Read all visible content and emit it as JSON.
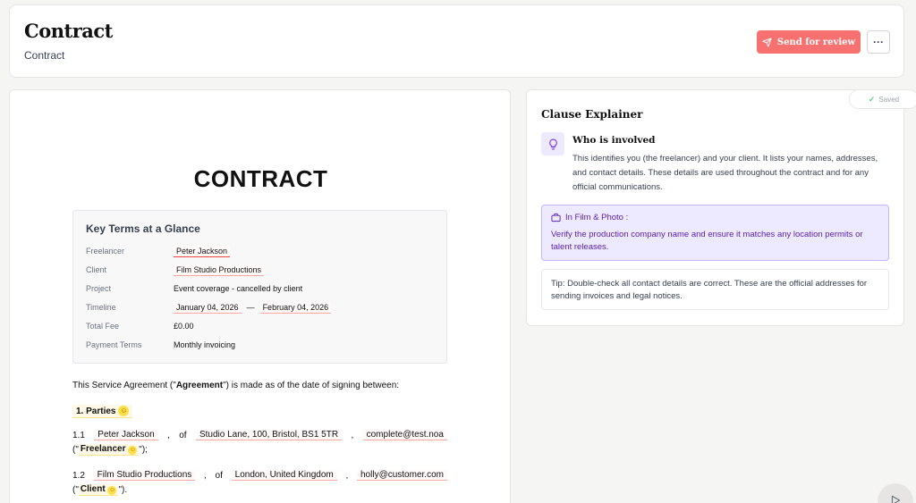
{
  "header": {
    "title": "Contract",
    "subtitle": "Contract",
    "send_label": "Send for review",
    "more_label": "···"
  },
  "document": {
    "title": "CONTRACT",
    "key_terms": {
      "title": "Key Terms at a Glance",
      "rows": {
        "freelancer": {
          "label": "Freelancer",
          "value": "Peter Jackson"
        },
        "client": {
          "label": "Client",
          "value": "Film Studio Productions"
        },
        "project": {
          "label": "Project",
          "value": "Event coverage - cancelled by client"
        },
        "timeline": {
          "label": "Timeline",
          "start": "January 04, 2026",
          "sep": "—",
          "end": "February 04, 2026"
        },
        "total_fee": {
          "label": "Total Fee",
          "value": "£0.00"
        },
        "payment_terms": {
          "label": "Payment Terms",
          "value": "Monthly invoicing"
        }
      }
    },
    "intro": {
      "before": "This Service Agreement (\"",
      "term": "Agreement",
      "after": "\") is made as of the date of signing between:"
    },
    "section1": {
      "title": "1. Parties"
    },
    "clause_1_1": {
      "number": "1.1",
      "name": "Peter Jackson",
      "of": "of",
      "address": "Studio Lane, 100, Bristol, BS1 5TR",
      "email": "complete@test.noa",
      "open": "(\"",
      "term": "Freelancer",
      "close": "\");"
    },
    "clause_1_2": {
      "number": "1.2",
      "name": "Film Studio Productions",
      "of": "of",
      "address": "London, United Kingdom",
      "email": "holly@customer.com",
      "open": "(\"",
      "term": "Client",
      "close": "\")."
    }
  },
  "explainer": {
    "saved_label": "Saved",
    "title": "Clause Explainer",
    "who_title": "Who is involved",
    "who_body": "This identifies you (the freelancer) and your client. It lists your names, addresses, and contact details. These details are used throughout the contract and for any official communications.",
    "film_head": "In Film & Photo :",
    "film_body": "Verify the production company name and ensure it matches any location permits or talent releases.",
    "tip": "Tip: Double-check all contact details are correct. These are the official addresses for sending invoices and legal notices."
  },
  "colors": {
    "accent_red": "#f87171",
    "purple_bg": "#ede9fe",
    "purple_text": "#5b21b6"
  }
}
